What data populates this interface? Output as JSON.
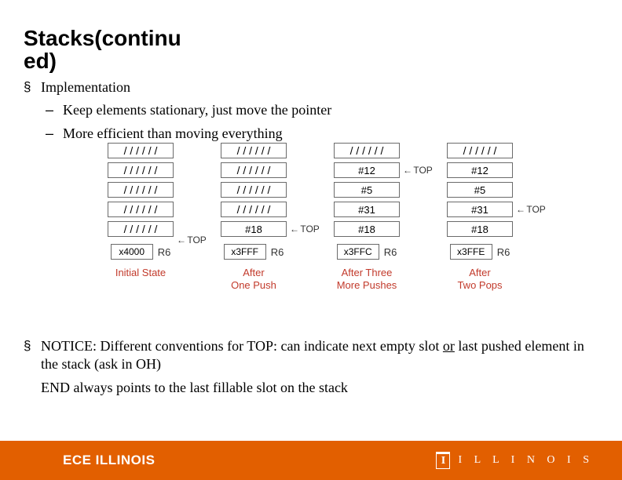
{
  "title_line1": "Stacks(continu",
  "title_line2": "ed)",
  "implementation_label": "Implementation",
  "sub1": "Keep elements stationary, just move the pointer",
  "sub2": "More efficient than moving  everything",
  "section_sym": "§",
  "dash_sym": "–",
  "diagram": {
    "hatch": "/ / / / / /",
    "top_label": "TOP",
    "r6_label": "R6",
    "columns": [
      {
        "cells": [
          "hatch",
          "hatch",
          "hatch",
          "hatch",
          "hatch"
        ],
        "reg": "x4000",
        "caption": "Initial State",
        "top_index": 5
      },
      {
        "cells": [
          "hatch",
          "hatch",
          "hatch",
          "hatch",
          "#18"
        ],
        "reg": "x3FFF",
        "caption": "After\nOne Push",
        "top_index": 4
      },
      {
        "cells": [
          "hatch",
          "#12",
          "#5",
          "#31",
          "#18"
        ],
        "reg": "x3FFC",
        "caption": "After Three\nMore Pushes",
        "top_index": 1
      },
      {
        "cells": [
          "hatch",
          "#12",
          "#5",
          "#31",
          "#18"
        ],
        "reg": "x3FFE",
        "caption": "After\nTwo Pops",
        "top_index": 3
      }
    ]
  },
  "notice_pre": "NOTICE: Different conventions for TOP: can indicate next empty slot ",
  "notice_or": "or",
  "notice_post": " last pushed element in the stack (ask in OH)",
  "end_line": "END always points to the last fillable slot on the stack",
  "footer_left": "ECE ILLINOIS",
  "footer_right": "I L L I N O I S"
}
